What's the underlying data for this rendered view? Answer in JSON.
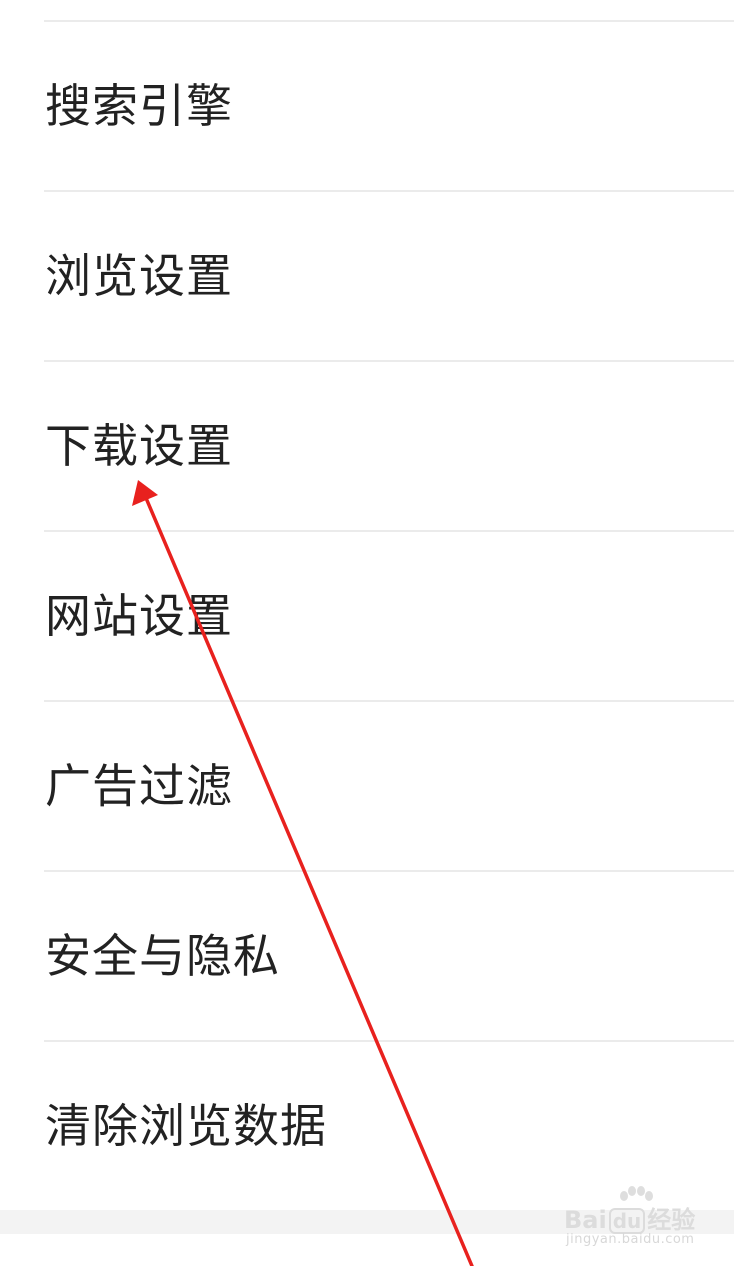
{
  "settings": {
    "items": [
      {
        "label": "搜索引擎"
      },
      {
        "label": "浏览设置"
      },
      {
        "label": "下载设置"
      },
      {
        "label": "网站设置"
      },
      {
        "label": "广告过滤"
      },
      {
        "label": "安全与隐私"
      },
      {
        "label": "清除浏览数据"
      }
    ]
  },
  "annotation": {
    "arrow_color": "#e8211e"
  },
  "watermark": {
    "brand_prefix": "Bai",
    "brand_box": "du",
    "brand_suffix": "经验",
    "subtext": "jingyan.baidu.com"
  }
}
